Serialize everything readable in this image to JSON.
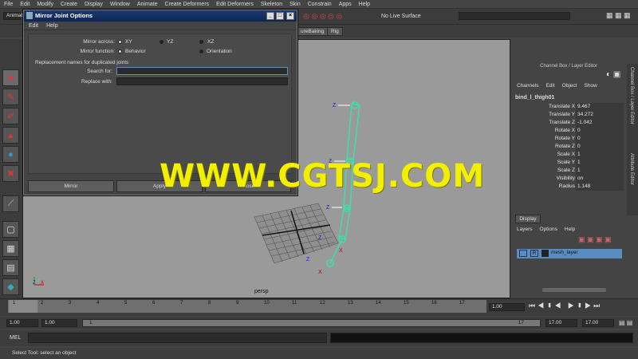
{
  "menu": [
    "File",
    "Edit",
    "Modify",
    "Create",
    "Display",
    "Window",
    "Animate",
    "Create Deformers",
    "Edit Deformers",
    "Skeleton",
    "Skin",
    "Constrain",
    "Apps",
    "Help"
  ],
  "status": {
    "mode": "Animation",
    "live_surface": "No Live Surface"
  },
  "shelf_tabs": [
    "ureBaking",
    "Rig"
  ],
  "dialog": {
    "title": "Mirror Joint Options",
    "menu": [
      "Edit",
      "Help"
    ],
    "mirror_across_label": "Mirror across:",
    "across_options": [
      "XY",
      "YZ",
      "XZ"
    ],
    "mirror_function_label": "Mirror function:",
    "function_options": [
      "Behavior",
      "Orientation"
    ],
    "replacement_heading": "Replacement names for duplicated joints",
    "search_label": "Search for:",
    "replace_label": "Replace with:",
    "search_value": "",
    "replace_value": "",
    "buttons": [
      "Mirror",
      "Apply",
      "Close"
    ]
  },
  "channel_box": {
    "title": "Channel Box / Layer Editor",
    "menu": [
      "Channels",
      "Edit",
      "Object",
      "Show"
    ],
    "node": "bind_l_thigh01",
    "attributes": [
      {
        "name": "Translate X",
        "value": "9.467"
      },
      {
        "name": "Translate Y",
        "value": "34.272"
      },
      {
        "name": "Translate Z",
        "value": "-1.042"
      },
      {
        "name": "Rotate X",
        "value": "0"
      },
      {
        "name": "Rotate Y",
        "value": "0"
      },
      {
        "name": "Rotate Z",
        "value": "0"
      },
      {
        "name": "Scale X",
        "value": "1"
      },
      {
        "name": "Scale Y",
        "value": "1"
      },
      {
        "name": "Scale Z",
        "value": "1"
      },
      {
        "name": "Visibility",
        "value": "on"
      },
      {
        "name": "Radius",
        "value": "1.148"
      }
    ],
    "side_tabs": [
      "Channel Box / Layer Editor",
      "Attribute Editor"
    ]
  },
  "layers": {
    "tab": "Display",
    "menu": [
      "Layers",
      "Options",
      "Help"
    ],
    "layer_r": "R",
    "layer_name": "mesh_layer"
  },
  "viewport": {
    "camera": "persp",
    "axes": [
      "Z",
      "X",
      "Y"
    ]
  },
  "timeline": {
    "ticks": [
      "1",
      "2",
      "3",
      "4",
      "5",
      "6",
      "7",
      "8",
      "9",
      "10",
      "11",
      "12",
      "13",
      "14",
      "15",
      "16",
      "17"
    ],
    "current_frame": "1.00"
  },
  "range": {
    "start": "1.00",
    "start2": "1.00",
    "slider_start": "1",
    "slider_end": "17",
    "end": "17.00",
    "end2": "17.00"
  },
  "command": {
    "label": "MEL"
  },
  "help_line": "Select Tool: select an object",
  "watermark": "WWW.CGTSJ.COM"
}
